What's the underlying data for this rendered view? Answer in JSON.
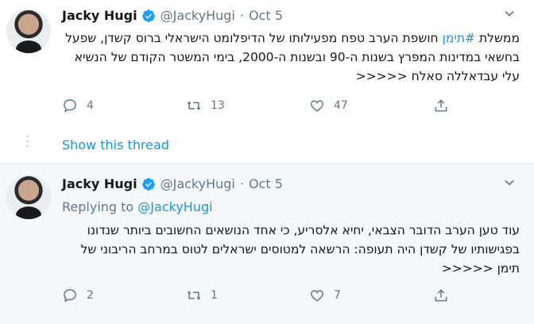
{
  "tweets": [
    {
      "name": "Jacky Hugi",
      "handle": "@JackyHugi",
      "separator": "·",
      "date": "Oct 5",
      "body_parts": [
        "ממשלת ",
        "#תימן",
        " חושפת הערב טפח מפעילותו של הדיפלומט הישראלי ברוס קשדן, שפעל בחשאי במדינות המפרץ בשנות ה-90 ובשנות ה-2000, בימי המשטר הקודם של הנשיא עלי עבדאללה סאלח <<<<<"
      ],
      "replies": "4",
      "retweets": "13",
      "likes": "47"
    },
    {
      "name": "Jacky Hugi",
      "handle": "@JackyHugi",
      "separator": "·",
      "date": "Oct 5",
      "replying_prefix": "Replying to",
      "replying_handle": "@JackyHugi",
      "body": "עוד טען הערב הדובר הצבאי, יחיא אלסריע, כי אחד הנושאים החשובים ביותר שנדונו בפגישותיו של קשדן היה תעופה: הרשאה למטוסים ישראלים לטוס במרחב הריבוני של תימן <<<<<",
      "replies": "2",
      "retweets": "1",
      "likes": "7"
    }
  ],
  "show_thread": "Show this thread",
  "colors": {
    "accent": "#1b95e0",
    "muted": "#657786",
    "text": "#14171a"
  },
  "icons": [
    "verified-badge-icon",
    "chevron-down-icon",
    "reply-icon",
    "retweet-icon",
    "like-icon",
    "share-icon"
  ]
}
